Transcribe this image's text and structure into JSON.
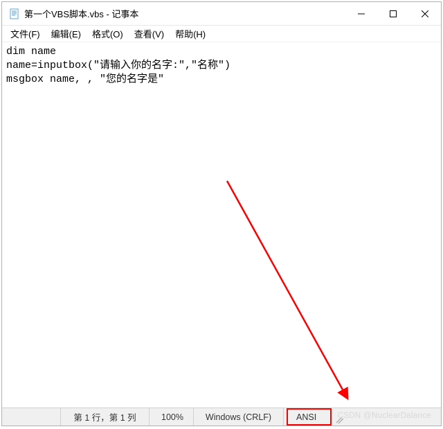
{
  "window": {
    "title": "第一个VBS脚本.vbs - 记事本"
  },
  "menu": {
    "file": "文件(F)",
    "edit": "编辑(E)",
    "format": "格式(O)",
    "view": "查看(V)",
    "help": "帮助(H)"
  },
  "editor": {
    "content": "dim name\nname=inputbox(\"请输入你的名字:\",\"名称\")\nmsgbox name, , \"您的名字是\""
  },
  "status": {
    "position": "第 1 行，第 1 列",
    "zoom": "100%",
    "eol": "Windows (CRLF)",
    "encoding": "ANSI"
  },
  "watermark": "CSDN @NuclearDalance"
}
